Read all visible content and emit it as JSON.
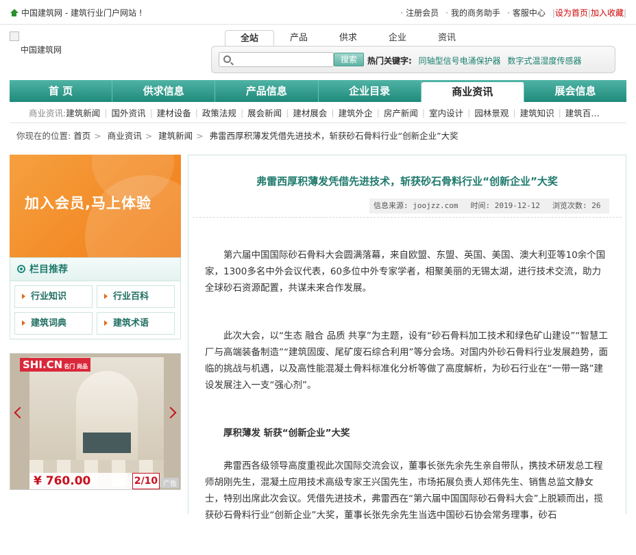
{
  "topbar": {
    "site_name": "中国建筑网 - 建筑行业门户网站 !",
    "links": [
      "注册会员",
      "我的商务助手",
      "客服中心"
    ],
    "set_home": "设为首页",
    "add_fav": "加入收藏"
  },
  "logo": {
    "alt": "中国建筑网"
  },
  "search": {
    "tabs": [
      "全站",
      "产品",
      "供求",
      "企业",
      "资讯"
    ],
    "active_tab": "全站",
    "button": "搜索",
    "hot_label": "热门关键字:",
    "hot_keywords": [
      "同轴型信号电涌保护器",
      "数字式温湿度传感器"
    ]
  },
  "mainnav": [
    "首 页",
    "供求信息",
    "产品信息",
    "企业目录",
    "商业资讯",
    "展会信息"
  ],
  "subnav": {
    "lead": "商业资讯:",
    "items": [
      "建筑新闻",
      "国外资讯",
      "建材设备",
      "政策法规",
      "展会新闻",
      "建材展会",
      "建筑外企",
      "房产新闻",
      "室内设计",
      "园林景观",
      "建筑知识",
      "建筑百…"
    ]
  },
  "breadcrumb": {
    "lead": "你现在的位置:",
    "items": [
      "首页",
      "商业资讯",
      "建筑新闻",
      "弗雷西厚积薄发凭借先进技术，斩获砂石骨料行业“创新企业”大奖"
    ]
  },
  "promo": {
    "text": "加入会员,马上体验"
  },
  "reco": {
    "title": "栏目推荐",
    "items": [
      "行业知识",
      "行业百科",
      "建筑词典",
      "建筑术语"
    ]
  },
  "ad": {
    "brand": "SHI.CN",
    "brand_sub": "名门 尚品",
    "price": "¥ 760.00",
    "pager": "2/10",
    "tag": "广告"
  },
  "article": {
    "title": "弗雷西厚积薄发凭借先进技术，斩获砂石骨料行业“创新企业”大奖",
    "source": "信息来源: joojzz.com",
    "time": "时间: 2019-12-12",
    "views": "浏览次数: 26",
    "p1": "第六届中国国际砂石骨料大会圆满落幕，来自欧盟、东盟、英国、美国、澳大利亚等10余个国家，1300多名中外会议代表，60多位中外专家学者，相聚美丽的无锡太湖，进行技术交流，助力全球砂石资源配置，共谋未来合作发展。",
    "p2": "此次大会，以“生态 融合 品质 共享”为主题，设有“砂石骨料加工技术和绿色矿山建设”“智慧工厂与高端装备制造”“建筑固废、尾矿废石综合利用”等分会场。对国内外砂石骨料行业发展趋势，面临的挑战与机遇，以及高性能混凝土骨料标准化分析等做了高度解析，为砂石行业在“一带一路”建设发展注入一支“强心剂”。",
    "subtitle": "厚积薄发 斩获“创新企业”大奖",
    "p3": "弗雷西各级领导高度重视此次国际交流会议，董事长张先余先生亲自带队，携技术研发总工程师胡刚先生，混凝土应用技术高级专家王兴国先生，市场拓展负责人郑伟先生、销售总监文静女士，特别出席此次会议。凭借先进技术，弗雷西在“第六届中国国际砂石骨料大会”上脱颖而出，揽获砂石骨料行业“创新企业”大奖，董事长张先余先生当选中国砂石协会常务理事，砂石"
  }
}
